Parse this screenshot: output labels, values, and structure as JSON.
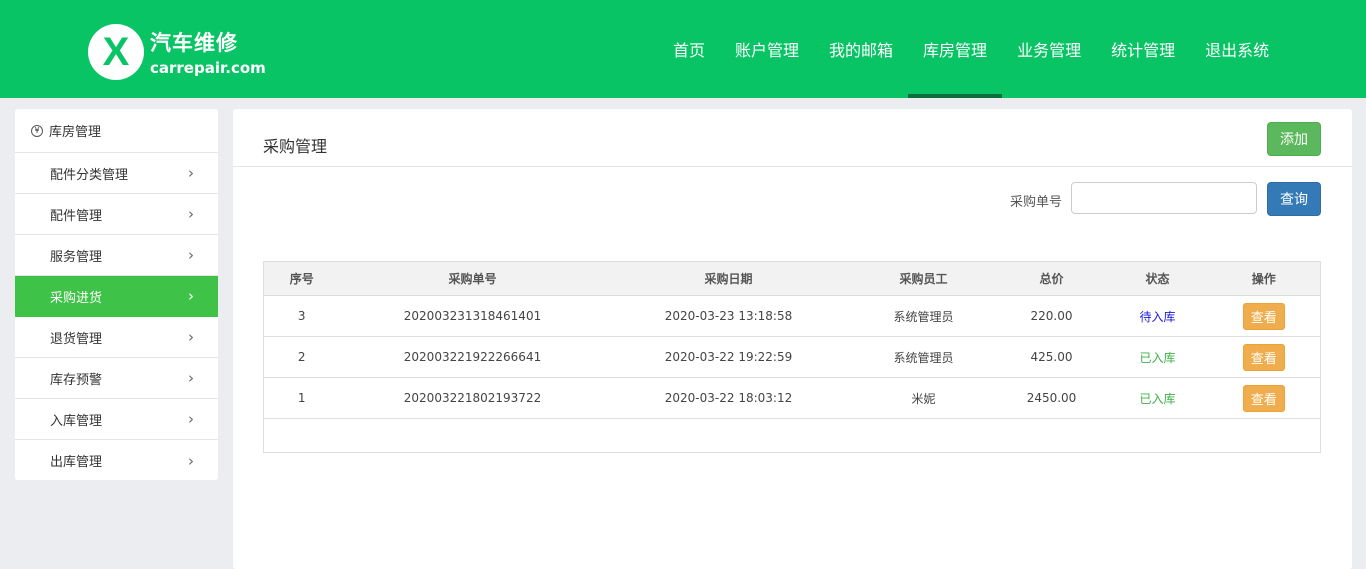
{
  "header": {
    "logo_cn": "汽车维修",
    "logo_en": "carrepair.com",
    "nav": [
      "首页",
      "账户管理",
      "我的邮箱",
      "库房管理",
      "业务管理",
      "统计管理",
      "退出系统"
    ],
    "active_nav": 3
  },
  "sidebar": {
    "title": "库房管理",
    "items": [
      "配件分类管理",
      "配件管理",
      "服务管理",
      "采购进货",
      "退货管理",
      "库存预警",
      "入库管理",
      "出库管理"
    ],
    "active": 3
  },
  "main": {
    "title": "采购管理",
    "add_label": "添加",
    "search_label": "采购单号",
    "search_value": "",
    "search_button": "查询",
    "columns": [
      "序号",
      "采购单号",
      "采购日期",
      "采购员工",
      "总价",
      "状态",
      "操作"
    ],
    "rows": [
      {
        "no": "3",
        "order": "202003231318461401",
        "date": "2020-03-23 13:18:58",
        "staff": "系统管理员",
        "total": "220.00",
        "status": "待入库",
        "action": "查看"
      },
      {
        "no": "2",
        "order": "202003221922266641",
        "date": "2020-03-22 19:22:59",
        "staff": "系统管理员",
        "total": "425.00",
        "status": "已入库",
        "action": "查看"
      },
      {
        "no": "1",
        "order": "202003221802193722",
        "date": "2020-03-22 18:03:12",
        "staff": "米妮",
        "total": "2450.00",
        "status": "已入库",
        "action": "查看"
      }
    ]
  },
  "colors": {
    "brand": "#08c465",
    "sidebar_active": "#3ec248",
    "pending": "#1a1adb",
    "done": "#3db045"
  }
}
